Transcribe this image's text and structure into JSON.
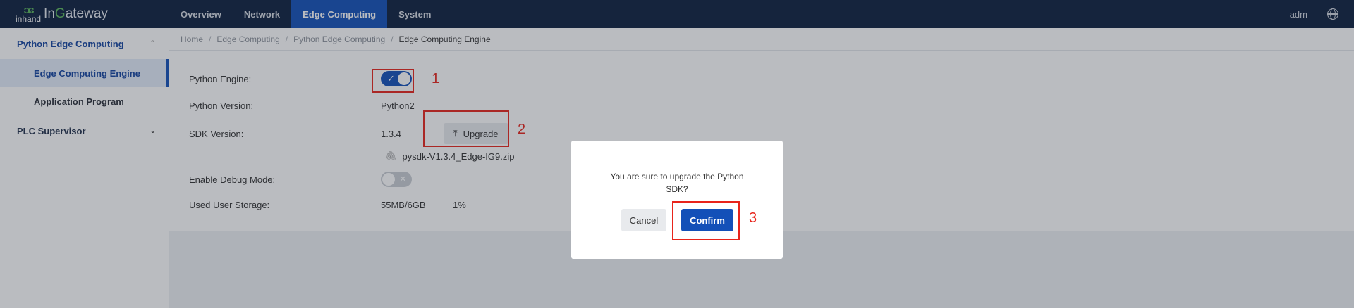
{
  "header": {
    "logo_glyph": "ɔɕ",
    "logo_brand": "inhand",
    "app_name_prefix": "In",
    "app_name_g": "G",
    "app_name_suffix": "ateway",
    "nav": [
      "Overview",
      "Network",
      "Edge Computing",
      "System"
    ],
    "active_nav": "Edge Computing",
    "user": "adm",
    "language_icon": "globe-icon"
  },
  "sidebar": {
    "groups": [
      {
        "label": "Python Edge Computing",
        "expanded": true,
        "items": [
          "Edge Computing Engine",
          "Application Program"
        ]
      },
      {
        "label": "PLC Supervisor",
        "expanded": false,
        "items": []
      }
    ],
    "active_item": "Edge Computing Engine",
    "chevron_up": "⌃",
    "chevron_down": "⌄"
  },
  "breadcrumb": [
    "Home",
    "Edge Computing",
    "Python Edge Computing",
    "Edge Computing Engine"
  ],
  "breadcrumb_sep": "/",
  "settings": {
    "python_engine_label": "Python Engine:",
    "python_engine_on": true,
    "python_version_label": "Python Version:",
    "python_version": "Python2",
    "sdk_version_label": "SDK Version:",
    "sdk_version": "1.3.4",
    "upgrade_label": "Upgrade",
    "sdk_file": "pysdk-V1.3.4_Edge-IG9.zip",
    "debug_label": "Enable Debug Mode:",
    "debug_on": false,
    "storage_label": "Used User Storage:",
    "storage_value": "55MB/6GB",
    "storage_percent": "1%"
  },
  "annotations": [
    "1",
    "2",
    "3"
  ],
  "dialog": {
    "message": "You are sure to upgrade the Python SDK?",
    "cancel": "Cancel",
    "confirm": "Confirm"
  },
  "colors": {
    "nav_bg": "#0d1f3e",
    "accent": "#1350b8",
    "annotation": "#e8241b"
  }
}
